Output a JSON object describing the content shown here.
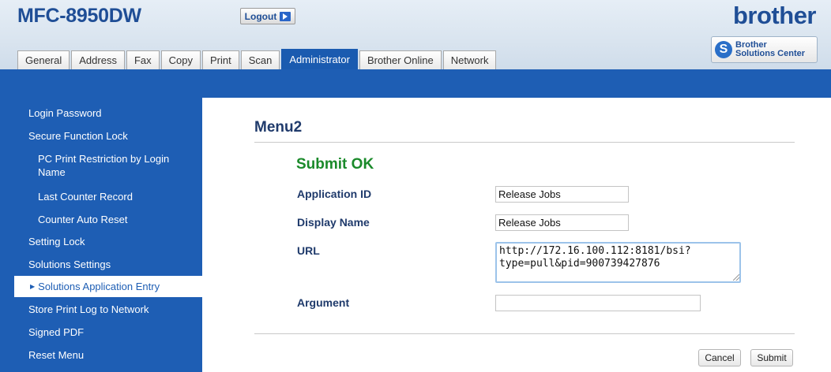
{
  "header": {
    "model": "MFC-8950DW",
    "logout_label": "Logout",
    "brand": "brother",
    "solutions_center": {
      "line1": "Brother",
      "line2": "Solutions Center"
    }
  },
  "tabs": [
    {
      "label": "General",
      "active": false
    },
    {
      "label": "Address",
      "active": false
    },
    {
      "label": "Fax",
      "active": false
    },
    {
      "label": "Copy",
      "active": false
    },
    {
      "label": "Print",
      "active": false
    },
    {
      "label": "Scan",
      "active": false
    },
    {
      "label": "Administrator",
      "active": true
    },
    {
      "label": "Brother Online",
      "active": false
    },
    {
      "label": "Network",
      "active": false
    }
  ],
  "sidebar": {
    "items": [
      {
        "label": "Login Password"
      },
      {
        "label": "Secure Function Lock"
      },
      {
        "label": "PC Print Restriction by Login Name"
      },
      {
        "label": "Last Counter Record"
      },
      {
        "label": "Counter Auto Reset"
      },
      {
        "label": "Setting Lock"
      },
      {
        "label": "Solutions Settings"
      },
      {
        "label": "Solutions Application Entry"
      },
      {
        "label": "Store Print Log to Network"
      },
      {
        "label": "Signed PDF"
      },
      {
        "label": "Reset Menu"
      }
    ],
    "active_index": 7
  },
  "main": {
    "title": "Menu2",
    "status": "Submit OK",
    "fields": {
      "application_id": {
        "label": "Application ID",
        "value": "Release Jobs"
      },
      "display_name": {
        "label": "Display Name",
        "value": "Release Jobs"
      },
      "url": {
        "label": "URL",
        "value": "http://172.16.100.112:8181/bsi?type=pull&pid=900739427876"
      },
      "argument": {
        "label": "Argument",
        "value": ""
      }
    },
    "buttons": {
      "cancel": "Cancel",
      "submit": "Submit"
    }
  },
  "colors": {
    "brand_blue": "#1f4e96",
    "nav_blue": "#1e5eb4",
    "status_green": "#1a8a2a"
  }
}
